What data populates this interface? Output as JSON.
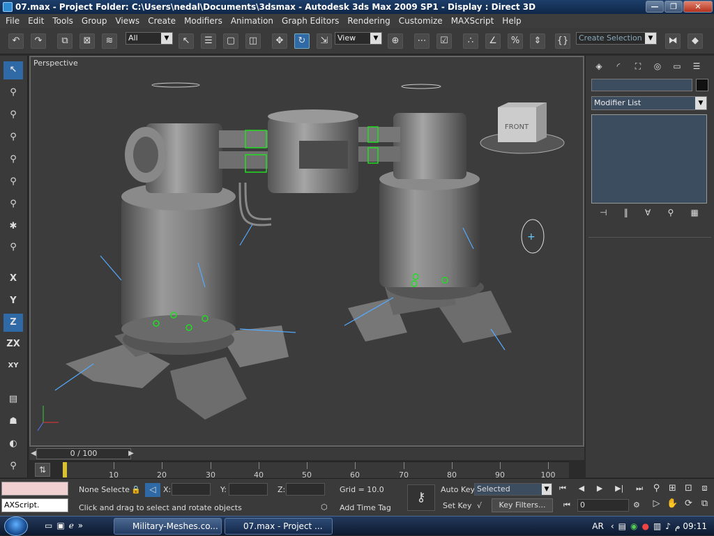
{
  "window": {
    "title": "07.max     - Project Folder: C:\\Users\\nedal\\Documents\\3dsmax     - Autodesk 3ds Max  2009 SP1     - Display : Direct 3D",
    "minimize": "—",
    "restore": "❐",
    "close": "✕"
  },
  "menu": [
    "File",
    "Edit",
    "Tools",
    "Group",
    "Views",
    "Create",
    "Modifiers",
    "Animation",
    "Graph Editors",
    "Rendering",
    "Customize",
    "MAXScript",
    "Help"
  ],
  "toolbar": {
    "selection_filter": "All",
    "ref_coord": "View",
    "named_selection": "Create Selection Se"
  },
  "axes": {
    "x": "X",
    "y": "Y",
    "z": "Z",
    "zx": "ZX",
    "xy": "XY"
  },
  "viewport": {
    "label": "Perspective",
    "viewcube_face": "FRONT"
  },
  "timeline": {
    "slider_label": "0 / 100",
    "ticks": [
      "10",
      "20",
      "30",
      "40",
      "50",
      "60",
      "70",
      "80",
      "90",
      "100"
    ]
  },
  "command_panel": {
    "modifier_list": "Modifier List",
    "name_value": ""
  },
  "status": {
    "maxscript": "AXScript.",
    "selection": "None Selecte",
    "x_label": "X:",
    "y_label": "Y:",
    "z_label": "Z:",
    "grid": "Grid = 10.0",
    "auto_key": "Auto Key",
    "set_key": "Set Key",
    "key_mode": "Selected",
    "key_filters": "Key Filters...",
    "prompt": "Click and drag to select and rotate objects",
    "add_time_tag": "Add Time Tag",
    "frame": "0"
  },
  "taskbar": {
    "items": [
      "Military-Meshes.co...",
      "07.max    - Project ..."
    ],
    "lang": "AR",
    "time": "09:11",
    "ampm": "م"
  },
  "colors": {
    "accent": "#2f6aa6",
    "gizmo": "#22dd22",
    "selection": "#55aaff"
  }
}
